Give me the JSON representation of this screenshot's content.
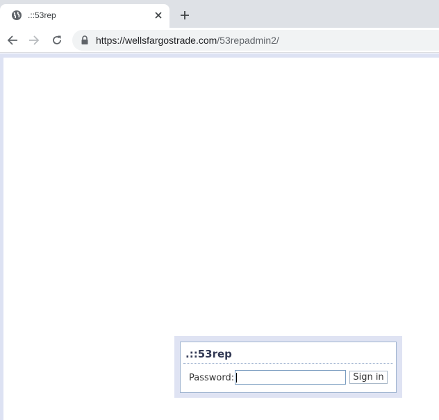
{
  "browser": {
    "tab": {
      "title": ".::53rep"
    },
    "address_bar": {
      "url_host": "https://wellsfargostrade.com",
      "url_path": "/53repadmin2/"
    }
  },
  "login": {
    "title": ".::53rep",
    "password_label": "Password:",
    "password_value": "",
    "signin_label": "Sign in"
  },
  "colors": {
    "page_frame": "#dde2f3",
    "login_border": "#9fb3d0",
    "title_text": "#333a55"
  }
}
